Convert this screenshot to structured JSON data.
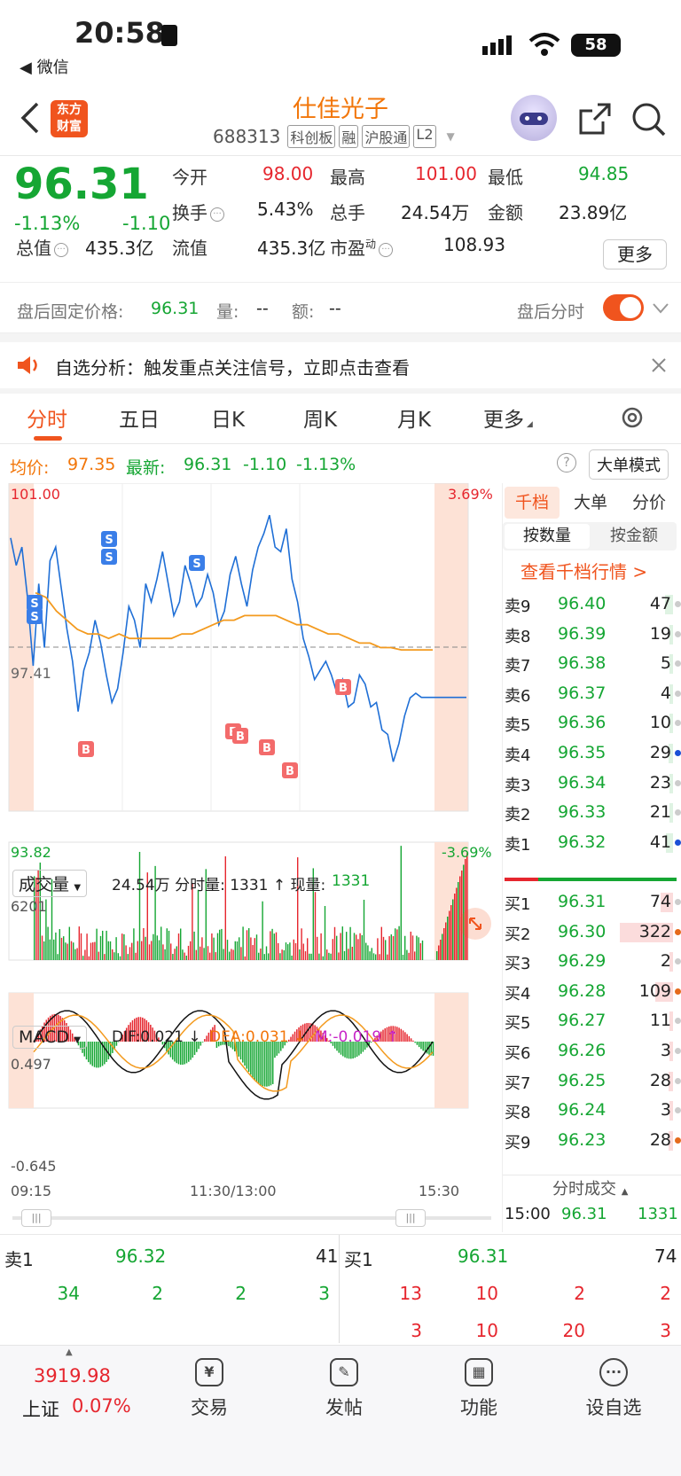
{
  "status": {
    "time": "20:58",
    "back_app": "◀ 微信",
    "battery": "58"
  },
  "header": {
    "title": "仕佳光子",
    "code": "688313",
    "tags": [
      "科创板",
      "融",
      "沪股通",
      "L2"
    ],
    "logo": "东方\n财富"
  },
  "quote": {
    "price": "96.31",
    "pct": "-1.13%",
    "chg": "-1.10",
    "fields": [
      {
        "label": "今开",
        "value": "98.00",
        "tone": "up"
      },
      {
        "label": "最高",
        "value": "101.00",
        "tone": "up"
      },
      {
        "label": "最低",
        "value": "94.85",
        "tone": "dn"
      },
      {
        "label": "换手",
        "value": "5.43%",
        "tone": ""
      },
      {
        "label": "总手",
        "value": "24.54万",
        "tone": ""
      },
      {
        "label": "金额",
        "value": "23.89亿",
        "tone": ""
      },
      {
        "label": "总值",
        "value": "435.3亿",
        "tone": ""
      },
      {
        "label": "流值",
        "value": "435.3亿",
        "tone": ""
      },
      {
        "label": "市盈",
        "sup": "动",
        "value": "108.93",
        "tone": ""
      }
    ],
    "more": "更多"
  },
  "after": {
    "label": "盘后固定价格:",
    "price": "96.31",
    "vol_label": "量:",
    "vol": "--",
    "amt_label": "额:",
    "amt": "--",
    "timeshare": "盘后分时"
  },
  "notice": {
    "text": "自选分析：触发重点关注信号，立即点击查看"
  },
  "tabs": [
    "分时",
    "五日",
    "日K",
    "周K",
    "月K",
    "更多"
  ],
  "line_info": {
    "avg_label": "均价:",
    "avg": "97.35",
    "last_label": "最新:",
    "last": "96.31",
    "chg": "-1.10",
    "pct": "-1.13%",
    "bigorder": "大单模式"
  },
  "chart_data": {
    "type": "line",
    "y_high": "101.00",
    "y_low": "93.82",
    "y_mid": "97.41",
    "pct_high": "3.69%",
    "pct_low": "-3.69%",
    "ylim": [
      93.82,
      101.0
    ],
    "price": [
      99.8,
      99.2,
      99.6,
      98.5,
      97.0,
      98.8,
      97.4,
      99.3,
      99.6,
      98.7,
      97.8,
      97.1,
      96.0,
      96.9,
      97.3,
      98.0,
      97.5,
      96.8,
      96.2,
      96.5,
      97.3,
      98.3,
      98.0,
      97.4,
      98.8,
      98.4,
      98.9,
      99.5,
      98.8,
      98.1,
      98.4,
      99.2,
      98.8,
      98.3,
      98.5,
      99.0,
      98.6,
      97.9,
      98.2,
      99.0,
      99.4,
      98.8,
      98.3,
      99.1,
      99.6,
      99.9,
      100.3,
      99.6,
      99.5,
      100.0,
      98.9,
      98.4,
      97.6,
      97.2,
      96.7,
      96.9,
      97.1,
      96.8,
      96.4,
      96.7,
      96.1,
      96.2,
      96.8,
      96.6,
      96.1,
      96.2,
      95.6,
      95.5,
      94.9,
      95.3,
      95.9,
      96.3,
      96.4,
      96.31,
      96.31,
      96.31,
      96.31,
      96.31,
      96.31,
      96.31,
      96.31,
      96.31
    ],
    "avg": [
      98.6,
      98.5,
      98.2,
      98.0,
      97.8,
      97.7,
      97.7,
      97.6,
      97.7,
      97.6,
      97.6,
      97.6,
      97.6,
      97.6,
      97.7,
      97.7,
      97.8,
      97.9,
      98.0,
      98.0,
      98.1,
      98.1,
      98.1,
      98.1,
      98.0,
      97.9,
      97.9,
      97.8,
      97.7,
      97.7,
      97.6,
      97.5,
      97.5,
      97.4,
      97.4,
      97.35,
      97.35,
      97.35,
      97.35
    ],
    "xlabels": [
      "09:15",
      "11:30/13:00",
      "15:30"
    ],
    "macd_high": "0.497",
    "macd_low": "-0.645"
  },
  "volume": {
    "select": "成交量",
    "text": "24.54万 分时量: 1331 ↑ 现量: ",
    "now": "1331",
    "max": "6201"
  },
  "macd": {
    "select": "MACD",
    "dif": "DIF:0.021 ↓",
    "dea": "DEA:0.031 ↓",
    "m": "M:-0.019 ↑"
  },
  "depth": {
    "tabs": [
      "千档",
      "大单",
      "分价"
    ],
    "sub": [
      "按数量",
      "按金额"
    ],
    "link": "查看千档行情 >",
    "asks": [
      [
        "卖9",
        "96.40",
        "47"
      ],
      [
        "卖8",
        "96.39",
        "19"
      ],
      [
        "卖7",
        "96.38",
        "5"
      ],
      [
        "卖6",
        "96.37",
        "4"
      ],
      [
        "卖5",
        "96.36",
        "10"
      ],
      [
        "卖4",
        "96.35",
        "29"
      ],
      [
        "卖3",
        "96.34",
        "23"
      ],
      [
        "卖2",
        "96.33",
        "21"
      ],
      [
        "卖1",
        "96.32",
        "41"
      ]
    ],
    "bids": [
      [
        "买1",
        "96.31",
        "74"
      ],
      [
        "买2",
        "96.30",
        "322"
      ],
      [
        "买3",
        "96.29",
        "2"
      ],
      [
        "买4",
        "96.28",
        "109"
      ],
      [
        "买5",
        "96.27",
        "11"
      ],
      [
        "买6",
        "96.26",
        "3"
      ],
      [
        "买7",
        "96.25",
        "28"
      ],
      [
        "买8",
        "96.24",
        "3"
      ],
      [
        "买9",
        "96.23",
        "28"
      ]
    ],
    "trade_title": "分时成交",
    "trade": [
      "15:00",
      "96.31",
      "1331"
    ]
  },
  "queue": {
    "sell_label": "卖1",
    "sell_price": "96.32",
    "sell_total": "41",
    "buy_label": "买1",
    "buy_price": "96.31",
    "buy_total": "74",
    "sell_orders": [
      "34",
      "2",
      "2",
      "3"
    ],
    "buy_row1": [
      "13",
      "10",
      "2",
      "2"
    ],
    "buy_row2": [
      "3",
      "10",
      "20",
      "3"
    ]
  },
  "bottom": {
    "index_value": "3919.98",
    "index_name": "上证",
    "index_pct": "0.07%",
    "items": [
      "交易",
      "发帖",
      "功能",
      "设自选"
    ]
  }
}
